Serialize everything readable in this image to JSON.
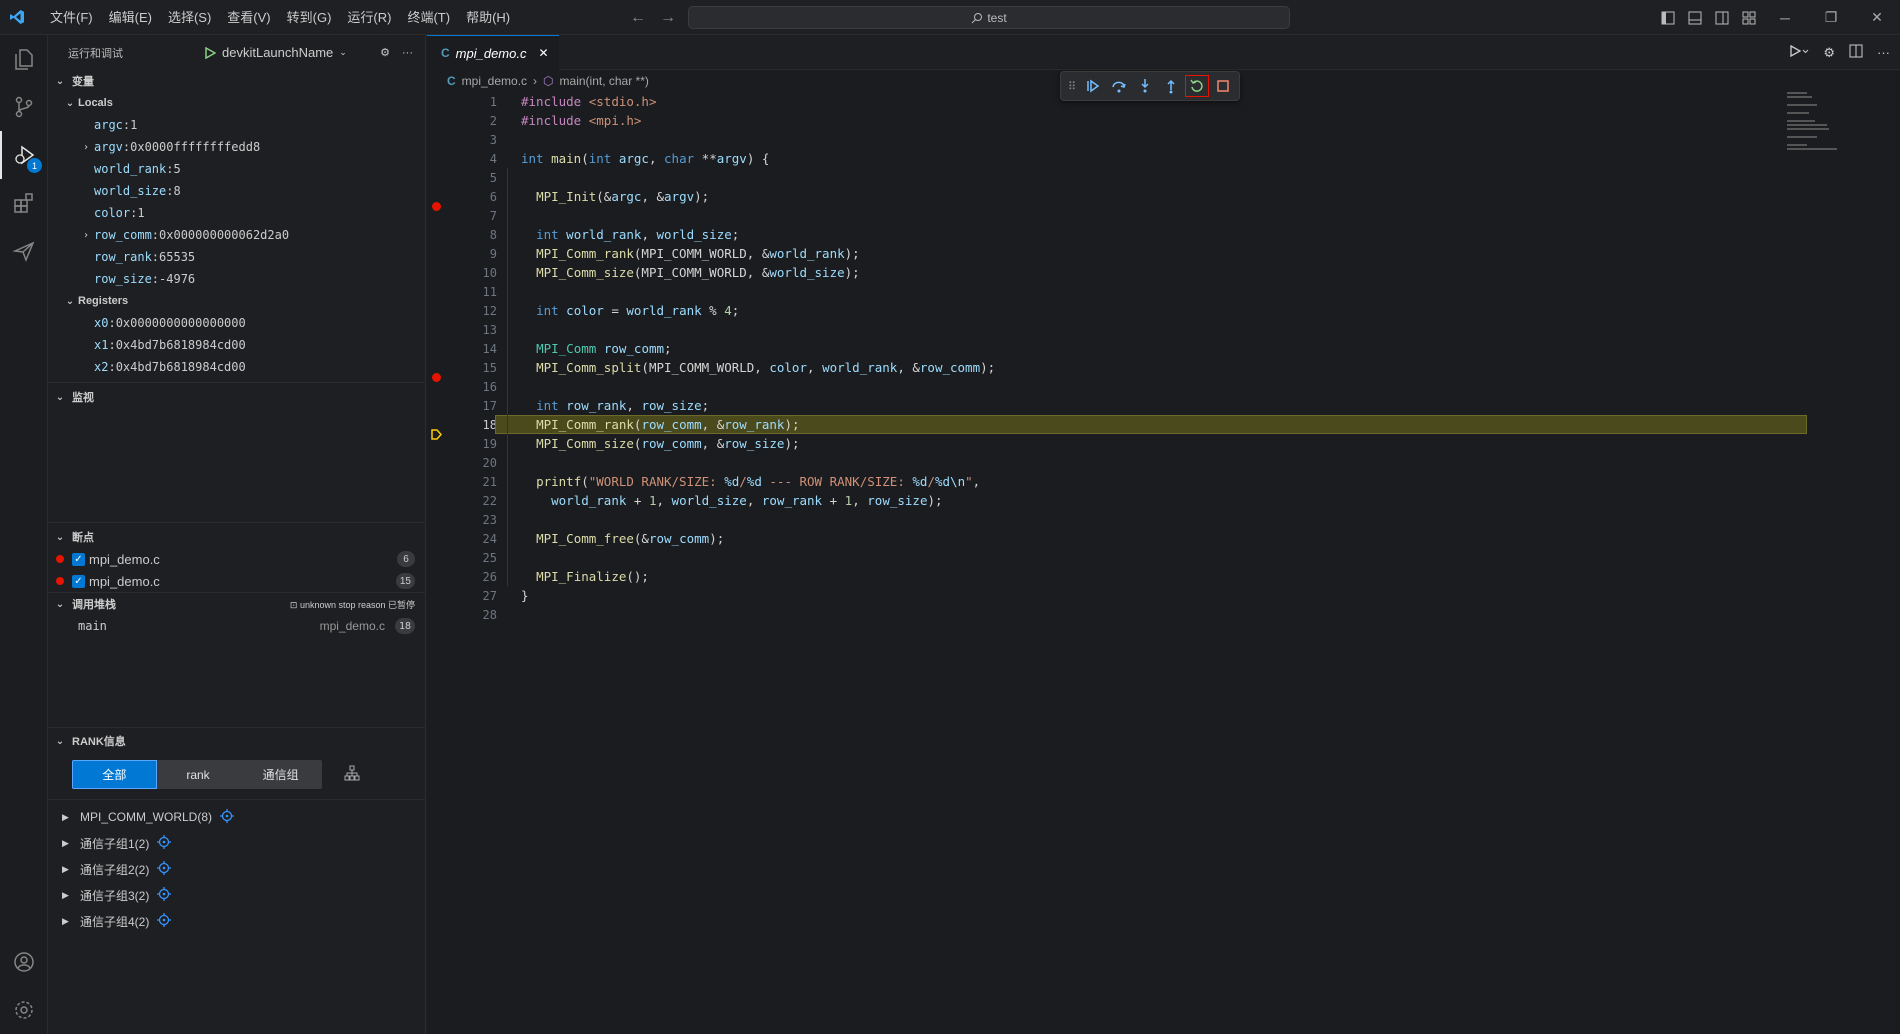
{
  "menu": [
    "文件(F)",
    "编辑(E)",
    "选择(S)",
    "查看(V)",
    "转到(G)",
    "运行(R)",
    "终端(T)",
    "帮助(H)"
  ],
  "search": {
    "text": "test"
  },
  "sidebar": {
    "title": "运行和调试",
    "launch_config": "devkitLaunchName",
    "variables": {
      "title": "变量",
      "locals_title": "Locals",
      "locals": [
        {
          "name": "argc",
          "value": "1",
          "expandable": false
        },
        {
          "name": "argv",
          "value": "0x0000ffffffffedd8",
          "expandable": true
        },
        {
          "name": "world_rank",
          "value": "5",
          "expandable": false
        },
        {
          "name": "world_size",
          "value": "8",
          "expandable": false
        },
        {
          "name": "color",
          "value": "1",
          "expandable": false
        },
        {
          "name": "row_comm",
          "value": "0x000000000062d2a0",
          "expandable": true
        },
        {
          "name": "row_rank",
          "value": "65535",
          "expandable": false
        },
        {
          "name": "row_size",
          "value": "-4976",
          "expandable": false
        }
      ],
      "registers_title": "Registers",
      "registers": [
        {
          "name": "x0",
          "value": "0x0000000000000000"
        },
        {
          "name": "x1",
          "value": "0x4bd7b6818984cd00"
        },
        {
          "name": "x2",
          "value": "0x4bd7b6818984cd00"
        }
      ]
    },
    "watch": {
      "title": "监视"
    },
    "breakpoints": {
      "title": "断点",
      "items": [
        {
          "file": "mpi_demo.c",
          "line": "6"
        },
        {
          "file": "mpi_demo.c",
          "line": "15"
        }
      ]
    },
    "callstack": {
      "title": "调用堆栈",
      "status": "unknown stop reason 已暂停",
      "frames": [
        {
          "name": "main",
          "file": "mpi_demo.c",
          "line": "18"
        }
      ]
    },
    "rank": {
      "title": "RANK信息",
      "tabs": [
        "全部",
        "rank",
        "通信组"
      ],
      "groups": [
        "MPI_COMM_WORLD(8)",
        "通信子组1(2)",
        "通信子组2(2)",
        "通信子组3(2)",
        "通信子组4(2)"
      ]
    }
  },
  "activity_badge": "1",
  "editor": {
    "tab": "mpi_demo.c",
    "breadcrumb_file": "mpi_demo.c",
    "breadcrumb_symbol": "main(int, char **)",
    "current_line": 18,
    "breakpoint_lines": [
      6,
      15
    ]
  },
  "colors": {
    "accent": "#0078d4",
    "breakpoint": "#e51400",
    "current_line": "#4b4a1d"
  }
}
